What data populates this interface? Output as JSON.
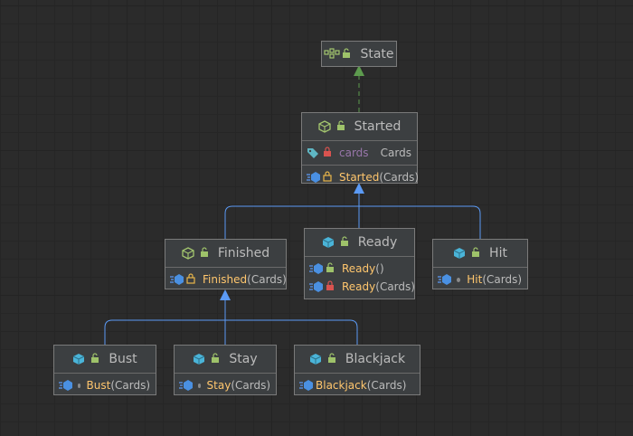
{
  "diagram": {
    "nodes": {
      "state": {
        "title": "State",
        "kind": "interface"
      },
      "started": {
        "title": "Started",
        "kind": "abstract-class",
        "fields": [
          {
            "name": "cards",
            "type": "Cards",
            "visibility": "private"
          }
        ],
        "methods": [
          {
            "name": "Started",
            "params": "(Cards)",
            "visibility": "protected"
          }
        ]
      },
      "finished": {
        "title": "Finished",
        "kind": "abstract-class",
        "methods": [
          {
            "name": "Finished",
            "params": "(Cards)",
            "visibility": "protected"
          }
        ]
      },
      "ready": {
        "title": "Ready",
        "kind": "class",
        "methods": [
          {
            "name": "Ready",
            "params": "()",
            "visibility": "public"
          },
          {
            "name": "Ready",
            "params": "(Cards)",
            "visibility": "private"
          }
        ]
      },
      "hit": {
        "title": "Hit",
        "kind": "class",
        "methods": [
          {
            "name": "Hit",
            "params": "(Cards)",
            "visibility": "package"
          }
        ]
      },
      "bust": {
        "title": "Bust",
        "kind": "class",
        "methods": [
          {
            "name": "Bust",
            "params": "(Cards)",
            "visibility": "package"
          }
        ]
      },
      "stay": {
        "title": "Stay",
        "kind": "class",
        "methods": [
          {
            "name": "Stay",
            "params": "(Cards)",
            "visibility": "package"
          }
        ]
      },
      "blackjack": {
        "title": "Blackjack",
        "kind": "class",
        "methods": [
          {
            "name": "Blackjack",
            "params": "(Cards)",
            "visibility": "public"
          }
        ]
      }
    },
    "edges": [
      {
        "from": "started",
        "to": "state",
        "type": "implements"
      },
      {
        "from": "finished",
        "to": "started",
        "type": "extends"
      },
      {
        "from": "ready",
        "to": "started",
        "type": "extends"
      },
      {
        "from": "hit",
        "to": "started",
        "type": "extends"
      },
      {
        "from": "bust",
        "to": "finished",
        "type": "extends"
      },
      {
        "from": "stay",
        "to": "finished",
        "type": "extends"
      },
      {
        "from": "blackjack",
        "to": "finished",
        "type": "extends"
      }
    ],
    "colors": {
      "background": "#2b2b2b",
      "node_fill": "#3c3f41",
      "node_border": "#7a7a7a",
      "extends_line": "#5b9af5",
      "implements_line": "#5d9b4e",
      "method_name": "#ffc66d",
      "field_name": "#9876aa"
    }
  }
}
